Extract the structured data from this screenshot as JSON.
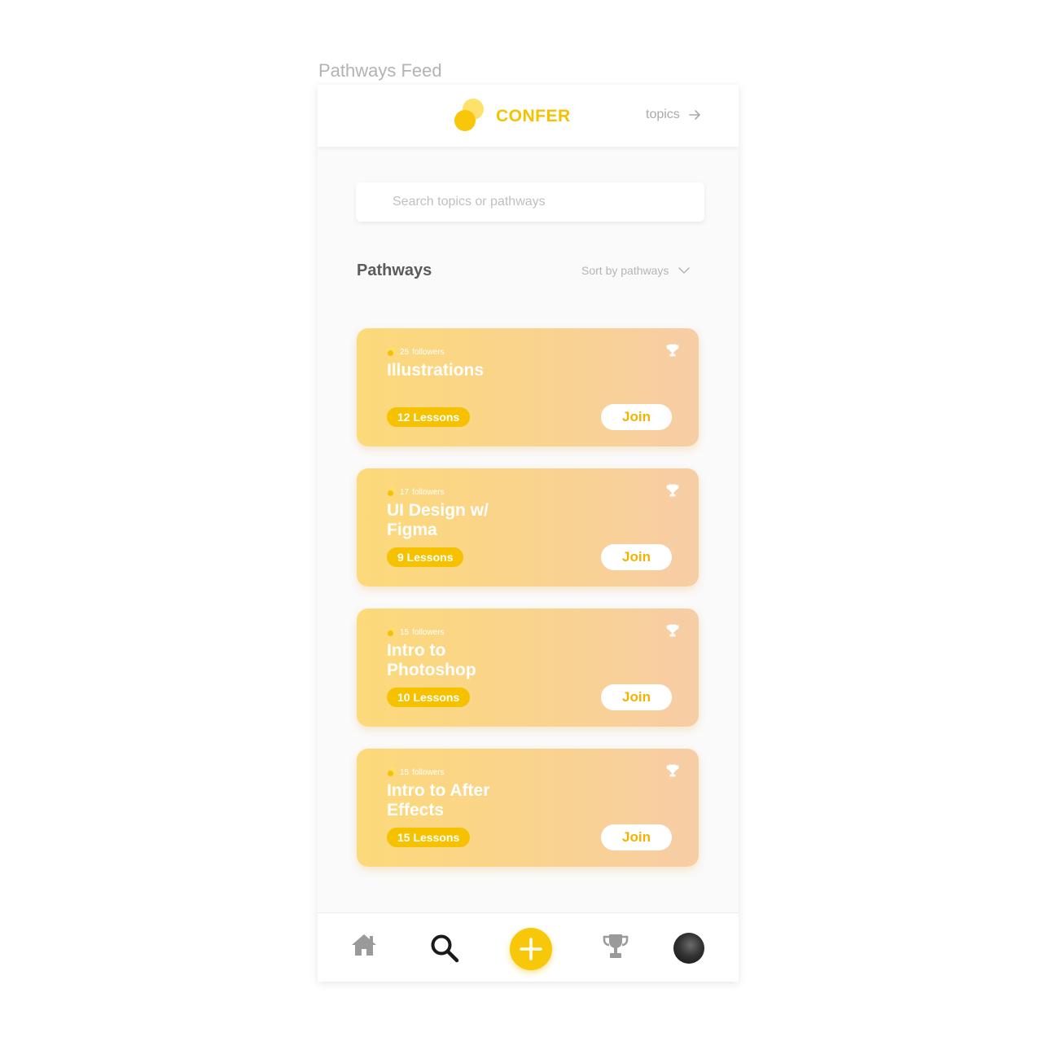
{
  "frame_label": "Pathways Feed",
  "header": {
    "brand": "CONFER",
    "topics_link": "topics",
    "icons": {
      "logo": "confer-logo",
      "arrow": "arrow-right-icon"
    }
  },
  "search": {
    "placeholder": "Search topics or pathways",
    "value": ""
  },
  "section": {
    "title": "Pathways",
    "sort_label": "Sort by pathways"
  },
  "cards": [
    {
      "followers_count": "25",
      "followers_label": "followers",
      "title": "Illustrations",
      "lessons": "12 Lessons",
      "join_label": "Join"
    },
    {
      "followers_count": "17",
      "followers_label": "followers",
      "title": "UI Design w/ Figma",
      "lessons": "9 Lessons",
      "join_label": "Join"
    },
    {
      "followers_count": "15",
      "followers_label": "followers",
      "title": "Intro to Photoshop",
      "lessons": "10 Lessons",
      "join_label": "Join"
    },
    {
      "followers_count": "15",
      "followers_label": "followers",
      "title": "Intro to After Effects",
      "lessons": "15 Lessons",
      "join_label": "Join"
    }
  ],
  "bottom_nav": {
    "items": [
      "home-icon",
      "search-icon",
      "add-icon",
      "trophy-icon",
      "profile-avatar"
    ],
    "active": "search-icon"
  },
  "colors": {
    "brand_yellow": "#f6c200",
    "logo_light": "#fde16b",
    "card_gradient_start": "#fcd97a",
    "card_gradient_end": "#f7cda6",
    "join_text": "#f2b300",
    "muted_text": "#a9a9a9"
  }
}
